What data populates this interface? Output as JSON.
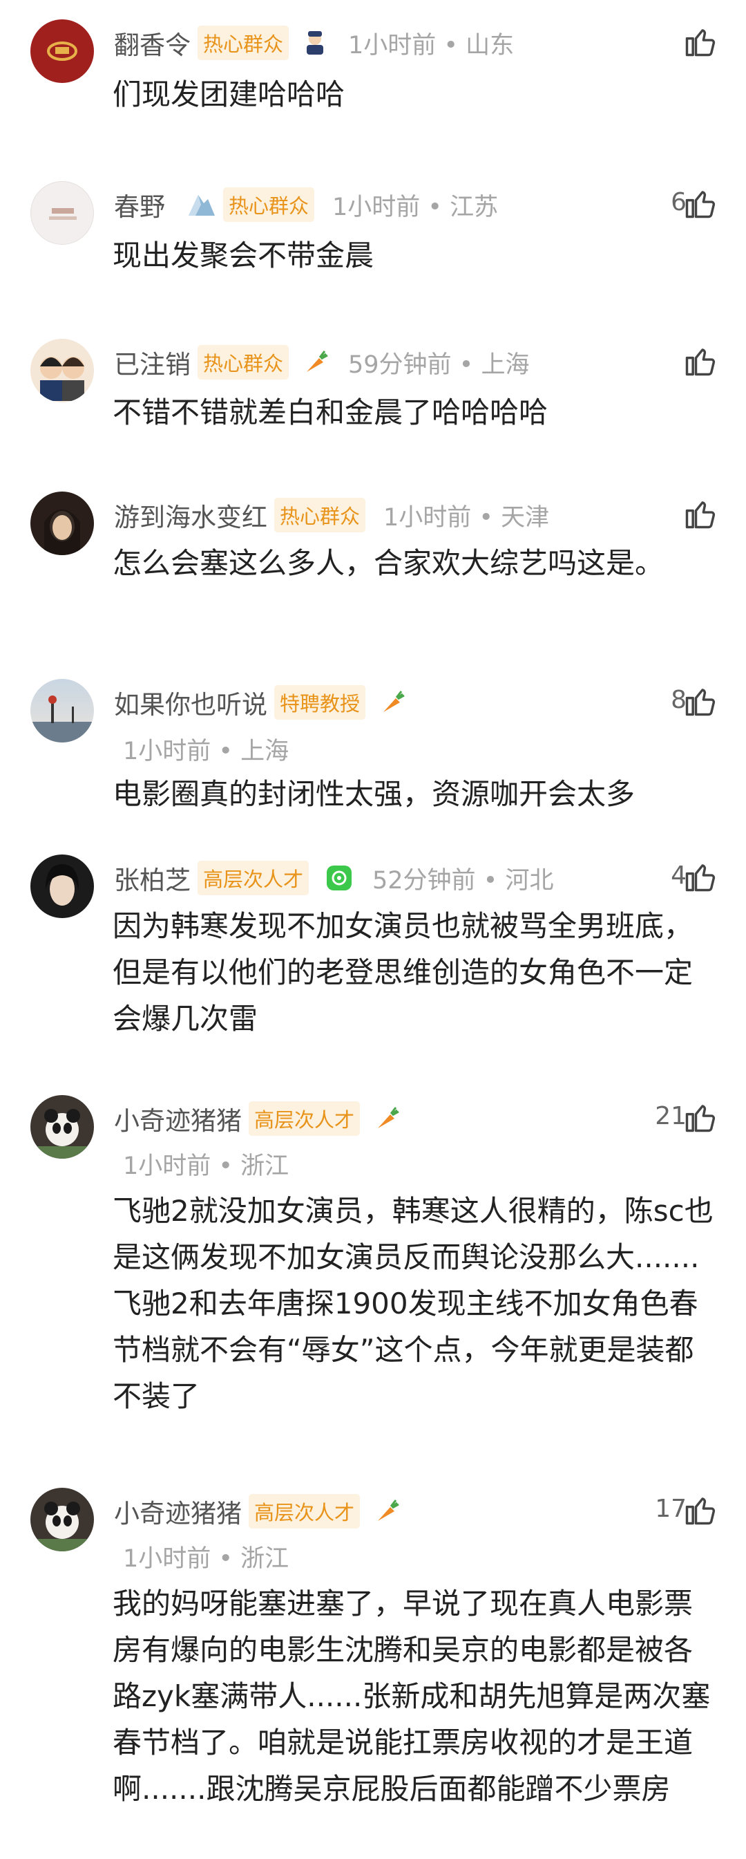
{
  "comments": [
    {
      "name": "翻香令",
      "badge": "热心群众",
      "meta": "1小时前 • 山东",
      "likes": "",
      "text": "们现发团建哈哈哈"
    },
    {
      "name": "春野",
      "badge": "热心群众",
      "meta": "1小时前 • 江苏",
      "likes": "6",
      "text": "现出发聚会不带金晨"
    },
    {
      "name": "已注销",
      "badge": "热心群众",
      "meta": "59分钟前 • 上海",
      "likes": "",
      "text": "不错不错就差白和金晨了哈哈哈哈"
    },
    {
      "name": "游到海水变红",
      "badge": "热心群众",
      "meta": "1小时前 • 天津",
      "likes": "",
      "text": "怎么会塞这么多人，合家欢大综艺吗这是。"
    },
    {
      "name": "如果你也听说",
      "badge": "特聘教授",
      "meta": "1小时前 • 上海",
      "likes": "8",
      "text": "电影圈真的封闭性太强，资源咖开会太多"
    },
    {
      "name": "张柏芝",
      "badge": "高层次人才",
      "meta": "52分钟前 • 河北",
      "likes": "4",
      "text": "因为韩寒发现不加女演员也就被骂全男班底，但是有以他们的老登思维创造的女角色不一定会爆几次雷"
    },
    {
      "name": "小奇迹猪猪",
      "badge": "高层次人才",
      "meta": "1小时前 • 浙江",
      "likes": "21",
      "text": "飞驰2就没加女演员，韩寒这人很精的，陈sc也是这俩发现不加女演员反而舆论没那么大.......飞驰2和去年唐探1900发现主线不加女角色春节档就不会有“辱女”这个点，今年就更是装都不装了"
    },
    {
      "name": "小奇迹猪猪",
      "badge": "高层次人才",
      "meta": "1小时前 • 浙江",
      "likes": "17",
      "text": "我的妈呀能塞进塞了，早说了现在真人电影票房有爆向的电影生沈腾和吴京的电影都是被各路zyk塞满带人......张新成和胡先旭算是两次塞春节档了。咱就是说能扛票房收视的才是王道啊.......跟沈腾吴京屁股后面都能蹭不少票房"
    }
  ]
}
